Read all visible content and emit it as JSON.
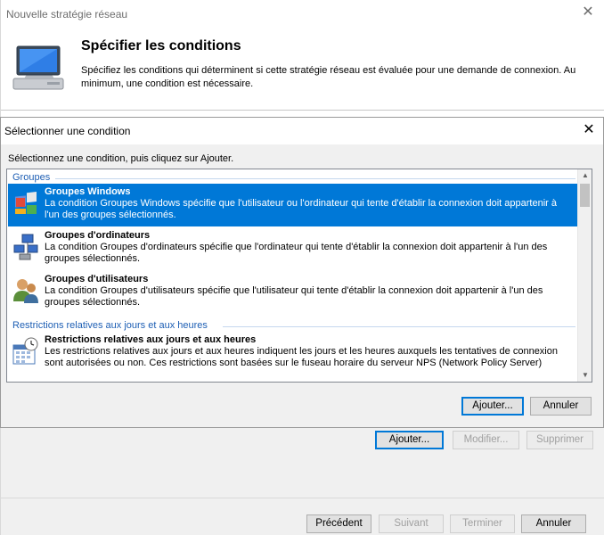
{
  "wizard": {
    "title": "Nouvelle stratégie réseau",
    "heading": "Spécifier les conditions",
    "description": "Spécifiez les conditions qui déterminent si cette stratégie réseau est évaluée pour une demande de connexion. Au minimum, une condition est nécessaire.",
    "buttons": {
      "add": "Ajouter...",
      "modify": "Modifier...",
      "remove": "Supprimer"
    },
    "footer": {
      "previous": "Précédent",
      "next": "Suivant",
      "finish": "Terminer",
      "cancel": "Annuler"
    }
  },
  "dialog": {
    "title": "Sélectionner une condition",
    "instruction": "Sélectionnez une condition, puis cliquez sur Ajouter.",
    "groups": [
      {
        "label": "Groupes",
        "items": [
          {
            "title": "Groupes Windows",
            "description": "La condition Groupes Windows spécifie que l'utilisateur ou l'ordinateur qui tente d'établir la connexion doit appartenir à l'un des groupes sélectionnés.",
            "icon": "windows-groups-icon",
            "selected": true
          },
          {
            "title": "Groupes d'ordinateurs",
            "description": "La condition Groupes d'ordinateurs spécifie que l'ordinateur qui tente d'établir la connexion doit appartenir à l'un des groupes sélectionnés.",
            "icon": "computer-groups-icon",
            "selected": false
          },
          {
            "title": "Groupes d'utilisateurs",
            "description": "La condition Groupes d'utilisateurs spécifie que l'utilisateur qui tente d'établir la connexion doit appartenir à l'un des groupes sélectionnés.",
            "icon": "user-groups-icon",
            "selected": false
          }
        ]
      },
      {
        "label": "Restrictions relatives aux jours et aux heures",
        "items": [
          {
            "title": "Restrictions relatives aux jours et aux heures",
            "description": "Les restrictions relatives aux jours et aux heures indiquent les jours et les heures auxquels les tentatives de connexion sont autorisées ou non. Ces restrictions sont basées sur le fuseau horaire du serveur NPS (Network Policy Server)",
            "icon": "calendar-clock-icon",
            "selected": false
          }
        ]
      }
    ],
    "buttons": {
      "add": "Ajouter...",
      "cancel": "Annuler"
    }
  },
  "colors": {
    "selection": "#0078d7",
    "group_header": "#1e5fb4",
    "dialog_bg": "#f0f0f0"
  }
}
